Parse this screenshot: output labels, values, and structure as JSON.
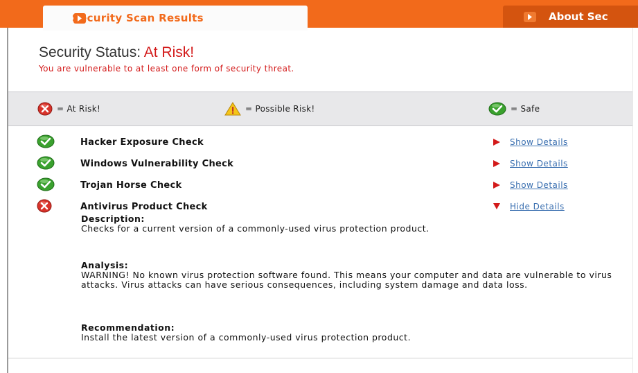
{
  "tabs": {
    "active": "Security Scan Results",
    "inactive": "About Sec"
  },
  "status": {
    "label": "Security Status: ",
    "value": "At Risk!",
    "subtitle": "You are vulnerable to at least one form of security threat."
  },
  "legend": {
    "at_risk": "= At Risk!",
    "possible": "= Possible Risk!",
    "safe": "= Safe"
  },
  "checks": [
    {
      "name": "Hacker Exposure Check",
      "link": "Show Details",
      "status": "safe"
    },
    {
      "name": "Windows Vulnerability Check",
      "link": "Show Details",
      "status": "safe"
    },
    {
      "name": "Trojan Horse Check",
      "link": "Show Details",
      "status": "safe"
    },
    {
      "name": "Antivirus Product Check",
      "link": "Hide Details",
      "status": "at-risk"
    }
  ],
  "details": {
    "description_head": "Description:",
    "description": "Checks for a current version of a commonly-used virus protection product.",
    "analysis_head": "Analysis:",
    "analysis": "WARNING! No known virus protection software found. This means your computer and data are vulnerable to virus attacks. Virus attacks can have serious consequences, including system damage and data loss.",
    "recommendation_head": "Recommendation:",
    "recommendation": "Install the latest version of a commonly-used virus protection product."
  },
  "colors": {
    "brand_orange": "#f26a1b",
    "risk_red": "#d31a1a",
    "safe_green": "#3aa12e",
    "link_blue": "#3a6fb0"
  }
}
